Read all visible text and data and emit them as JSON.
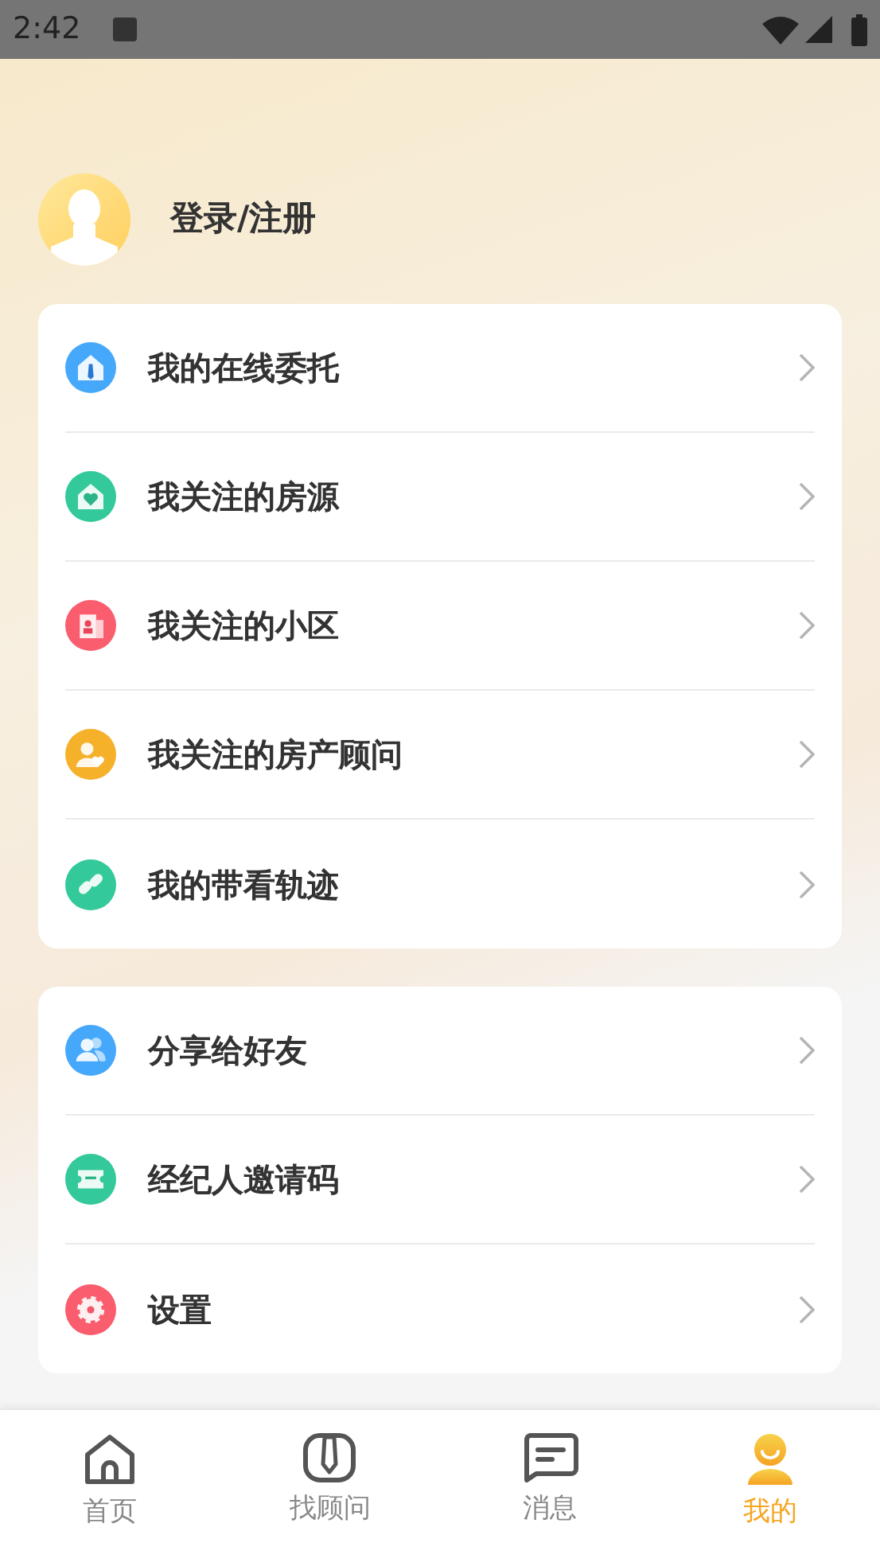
{
  "status_bar": {
    "time": "2:42"
  },
  "profile": {
    "login_label": "登录/注册"
  },
  "menu_groups": [
    {
      "items": [
        {
          "label": "我的在线委托",
          "kind": "house",
          "color": "#46a8fb"
        },
        {
          "label": "我关注的房源",
          "kind": "heart-house",
          "color": "#33c99a"
        },
        {
          "label": "我关注的小区",
          "kind": "building",
          "color": "#fa5d6d"
        },
        {
          "label": "我关注的房产顾问",
          "kind": "person-heart",
          "color": "#f6b12b"
        },
        {
          "label": "我的带看轨迹",
          "kind": "link",
          "color": "#33c99a"
        }
      ]
    },
    {
      "items": [
        {
          "label": "分享给好友",
          "kind": "people",
          "color": "#46a8fb"
        },
        {
          "label": "经纪人邀请码",
          "kind": "ticket",
          "color": "#33c99a"
        },
        {
          "label": "设置",
          "kind": "gear",
          "color": "#fa5d6d"
        }
      ]
    }
  ],
  "tab_bar": [
    {
      "label": "首页",
      "kind": "home",
      "selected": false
    },
    {
      "label": "找顾问",
      "kind": "advisor",
      "selected": false
    },
    {
      "label": "消息",
      "kind": "message",
      "selected": false
    },
    {
      "label": "我的",
      "kind": "me",
      "selected": true
    }
  ]
}
